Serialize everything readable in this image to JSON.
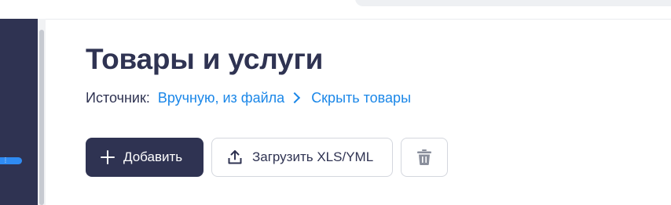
{
  "page": {
    "title": "Товары и услуги"
  },
  "source": {
    "label": "Источник:",
    "value_link": "Вручную, из файла",
    "hide_link": "Скрыть товары"
  },
  "actions": {
    "add_label": "Добавить",
    "upload_label": "Загрузить XLS/YML"
  },
  "icons": {
    "add": "plus-icon",
    "upload": "upload-icon",
    "delete": "trash-icon",
    "source_chevron": "chevron-right-icon"
  },
  "colors": {
    "brand_dark": "#2f3352",
    "link_blue": "#1b87e8",
    "sidebar_accent": "#2f8bf2"
  }
}
